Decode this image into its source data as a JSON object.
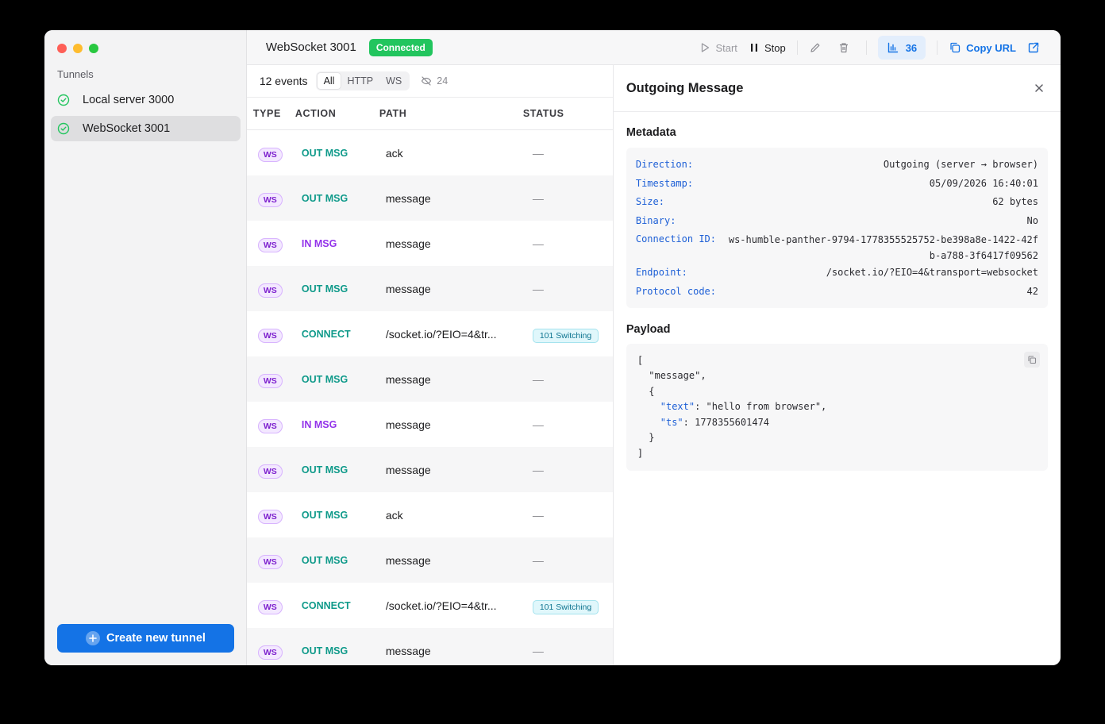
{
  "sidebar": {
    "section_title": "Tunnels",
    "tunnels": [
      {
        "name": "Local server 3000",
        "active": false
      },
      {
        "name": "WebSocket 3001",
        "active": true
      }
    ],
    "create_label": "Create new tunnel"
  },
  "topbar": {
    "tunnel_name": "WebSocket 3001",
    "status": "Connected",
    "start_label": "Start",
    "stop_label": "Stop",
    "stats_count": "36",
    "copy_url_label": "Copy URL"
  },
  "events": {
    "count_label": "12 events",
    "filters": [
      "All",
      "HTTP",
      "WS"
    ],
    "hidden_count": "24",
    "columns": {
      "type": "TYPE",
      "action": "ACTION",
      "path": "PATH",
      "status": "STATUS"
    },
    "rows": [
      {
        "type": "WS",
        "action": "OUT MSG",
        "kind": "out",
        "path": "ack",
        "status": "—"
      },
      {
        "type": "WS",
        "action": "OUT MSG",
        "kind": "out",
        "path": "message",
        "status": "—"
      },
      {
        "type": "WS",
        "action": "IN MSG",
        "kind": "in",
        "path": "message",
        "status": "—"
      },
      {
        "type": "WS",
        "action": "OUT MSG",
        "kind": "out",
        "path": "message",
        "status": "—"
      },
      {
        "type": "WS",
        "action": "CONNECT",
        "kind": "conn",
        "path": "/socket.io/?EIO=4&tr...",
        "status": "101 Switching"
      },
      {
        "type": "WS",
        "action": "OUT MSG",
        "kind": "out",
        "path": "message",
        "status": "—"
      },
      {
        "type": "WS",
        "action": "IN MSG",
        "kind": "in",
        "path": "message",
        "status": "—"
      },
      {
        "type": "WS",
        "action": "OUT MSG",
        "kind": "out",
        "path": "message",
        "status": "—"
      },
      {
        "type": "WS",
        "action": "OUT MSG",
        "kind": "out",
        "path": "ack",
        "status": "—"
      },
      {
        "type": "WS",
        "action": "OUT MSG",
        "kind": "out",
        "path": "message",
        "status": "—"
      },
      {
        "type": "WS",
        "action": "CONNECT",
        "kind": "conn",
        "path": "/socket.io/?EIO=4&tr...",
        "status": "101 Switching"
      },
      {
        "type": "WS",
        "action": "OUT MSG",
        "kind": "out",
        "path": "message",
        "status": "—"
      }
    ]
  },
  "detail": {
    "title": "Outgoing Message",
    "metadata_title": "Metadata",
    "metadata": [
      {
        "key": "Direction:",
        "value": "Outgoing (server → browser)"
      },
      {
        "key": "Timestamp:",
        "value": "05/09/2026 16:40:01"
      },
      {
        "key": "Size:",
        "value": "62 bytes"
      },
      {
        "key": "Binary:",
        "value": "No"
      },
      {
        "key": "Connection ID:",
        "value": "ws-humble-panther-9794-1778355525752-be398a8e-1422-42fb-a788-3f6417f09562"
      },
      {
        "key": "Endpoint:",
        "value": "/socket.io/?EIO=4&transport=websocket"
      },
      {
        "key": "Protocol code:",
        "value": "42"
      }
    ],
    "payload_title": "Payload",
    "payload": {
      "l1": "[",
      "l2": "  \"message\",",
      "l3": "  {",
      "l4_key": "\"text\"",
      "l4_val": ": \"hello from browser\",",
      "l5_key": "\"ts\"",
      "l5_val": ": 1778355601474",
      "l6": "  }",
      "l7": "]"
    }
  }
}
